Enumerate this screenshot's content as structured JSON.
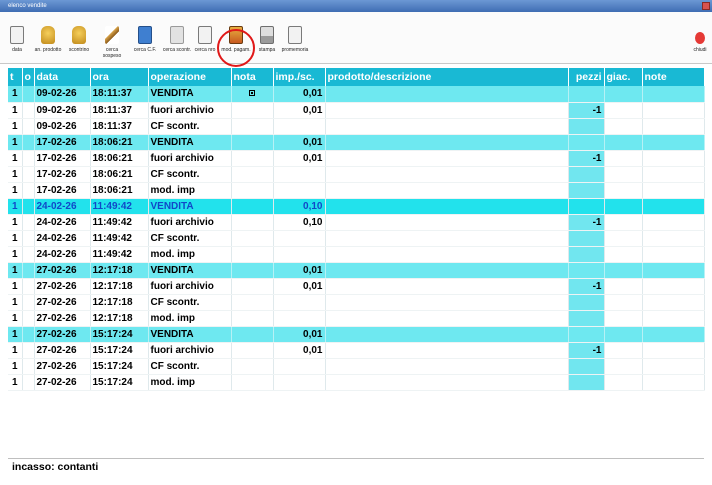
{
  "window": {
    "title": "elenco vendite"
  },
  "toolbar": {
    "items": [
      {
        "label": "data",
        "icon": "document-icon"
      },
      {
        "label": "an. prodotto",
        "icon": "product-icon"
      },
      {
        "label": "scontrino",
        "icon": "receipt-icon"
      },
      {
        "label": "cerca sospeso",
        "icon": "pen-icon"
      },
      {
        "label": "cerca C.F.",
        "icon": "id-card-icon"
      },
      {
        "label": "cerca scontr.",
        "icon": "page-icon"
      },
      {
        "label": "cerca nro",
        "icon": "search-page-icon"
      },
      {
        "label": "mod. pagam.",
        "icon": "payment-icon"
      },
      {
        "label": "stampa",
        "icon": "printer-icon"
      },
      {
        "label": "promemoria",
        "icon": "note-icon"
      }
    ],
    "close_label": "chiudi"
  },
  "table": {
    "headers": [
      "t",
      "o",
      "data",
      "ora",
      "operazione",
      "nota",
      "imp./sc.",
      "prodotto/descrizione",
      "pezzi",
      "giac.",
      "note"
    ],
    "rows": [
      {
        "t": "1",
        "o": "",
        "data": "09-02-26",
        "ora": "18:11:37",
        "operazione": "VENDITA",
        "nota": "mark",
        "imp": "0,01",
        "prodotto": "",
        "pezzi": "",
        "giac": "",
        "note": "",
        "style": "band"
      },
      {
        "t": "1",
        "o": "",
        "data": "09-02-26",
        "ora": "18:11:37",
        "operazione": "fuori archivio",
        "nota": "",
        "imp": "0,01",
        "prodotto": "",
        "pezzi": "-1",
        "giac": "",
        "note": "",
        "style": "normal"
      },
      {
        "t": "1",
        "o": "",
        "data": "09-02-26",
        "ora": "18:11:37",
        "operazione": "CF scontr.",
        "nota": "",
        "imp": "",
        "prodotto": "",
        "pezzi": "",
        "giac": "",
        "note": "",
        "style": "normal"
      },
      {
        "t": "1",
        "o": "",
        "data": "17-02-26",
        "ora": "18:06:21",
        "operazione": "VENDITA",
        "nota": "",
        "imp": "0,01",
        "prodotto": "",
        "pezzi": "",
        "giac": "",
        "note": "",
        "style": "band"
      },
      {
        "t": "1",
        "o": "",
        "data": "17-02-26",
        "ora": "18:06:21",
        "operazione": "fuori archivio",
        "nota": "",
        "imp": "0,01",
        "prodotto": "",
        "pezzi": "-1",
        "giac": "",
        "note": "",
        "style": "normal"
      },
      {
        "t": "1",
        "o": "",
        "data": "17-02-26",
        "ora": "18:06:21",
        "operazione": "CF scontr.",
        "nota": "",
        "imp": "",
        "prodotto": "",
        "pezzi": "",
        "giac": "",
        "note": "",
        "style": "normal"
      },
      {
        "t": "1",
        "o": "",
        "data": "17-02-26",
        "ora": "18:06:21",
        "operazione": "mod. imp",
        "nota": "",
        "imp": "",
        "prodotto": "",
        "pezzi": "",
        "giac": "",
        "note": "",
        "style": "normal"
      },
      {
        "t": "1",
        "o": "",
        "data": "24-02-26",
        "ora": "11:49:42",
        "operazione": "VENDITA",
        "nota": "",
        "imp": "0,10",
        "prodotto": "",
        "pezzi": "",
        "giac": "",
        "note": "",
        "style": "selected"
      },
      {
        "t": "1",
        "o": "",
        "data": "24-02-26",
        "ora": "11:49:42",
        "operazione": "fuori archivio",
        "nota": "",
        "imp": "0,10",
        "prodotto": "",
        "pezzi": "-1",
        "giac": "",
        "note": "",
        "style": "normal"
      },
      {
        "t": "1",
        "o": "",
        "data": "24-02-26",
        "ora": "11:49:42",
        "operazione": "CF scontr.",
        "nota": "",
        "imp": "",
        "prodotto": "",
        "pezzi": "",
        "giac": "",
        "note": "",
        "style": "normal"
      },
      {
        "t": "1",
        "o": "",
        "data": "24-02-26",
        "ora": "11:49:42",
        "operazione": "mod. imp",
        "nota": "",
        "imp": "",
        "prodotto": "",
        "pezzi": "",
        "giac": "",
        "note": "",
        "style": "normal"
      },
      {
        "t": "1",
        "o": "",
        "data": "27-02-26",
        "ora": "12:17:18",
        "operazione": "VENDITA",
        "nota": "",
        "imp": "0,01",
        "prodotto": "",
        "pezzi": "",
        "giac": "",
        "note": "",
        "style": "band"
      },
      {
        "t": "1",
        "o": "",
        "data": "27-02-26",
        "ora": "12:17:18",
        "operazione": "fuori archivio",
        "nota": "",
        "imp": "0,01",
        "prodotto": "",
        "pezzi": "-1",
        "giac": "",
        "note": "",
        "style": "normal"
      },
      {
        "t": "1",
        "o": "",
        "data": "27-02-26",
        "ora": "12:17:18",
        "operazione": "CF scontr.",
        "nota": "",
        "imp": "",
        "prodotto": "",
        "pezzi": "",
        "giac": "",
        "note": "",
        "style": "normal"
      },
      {
        "t": "1",
        "o": "",
        "data": "27-02-26",
        "ora": "12:17:18",
        "operazione": "mod. imp",
        "nota": "",
        "imp": "",
        "prodotto": "",
        "pezzi": "",
        "giac": "",
        "note": "",
        "style": "normal"
      },
      {
        "t": "1",
        "o": "",
        "data": "27-02-26",
        "ora": "15:17:24",
        "operazione": "VENDITA",
        "nota": "",
        "imp": "0,01",
        "prodotto": "",
        "pezzi": "",
        "giac": "",
        "note": "",
        "style": "band"
      },
      {
        "t": "1",
        "o": "",
        "data": "27-02-26",
        "ora": "15:17:24",
        "operazione": "fuori archivio",
        "nota": "",
        "imp": "0,01",
        "prodotto": "",
        "pezzi": "-1",
        "giac": "",
        "note": "",
        "style": "normal"
      },
      {
        "t": "1",
        "o": "",
        "data": "27-02-26",
        "ora": "15:17:24",
        "operazione": "CF scontr.",
        "nota": "",
        "imp": "",
        "prodotto": "",
        "pezzi": "",
        "giac": "",
        "note": "",
        "style": "normal"
      },
      {
        "t": "1",
        "o": "",
        "data": "27-02-26",
        "ora": "15:17:24",
        "operazione": "mod. imp",
        "nota": "",
        "imp": "",
        "prodotto": "",
        "pezzi": "",
        "giac": "",
        "note": "",
        "style": "normal"
      }
    ]
  },
  "footer": {
    "text": "incasso: contanti"
  },
  "colors": {
    "header": "#19b9d4",
    "band": "#6ee8f0",
    "selected": "#22e2ec",
    "selected_text": "#1148c8",
    "highlight_ring": "#e01818"
  }
}
